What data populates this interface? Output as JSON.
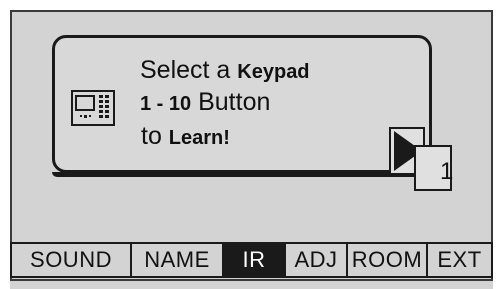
{
  "prompt": {
    "line1_normal": "Select a ",
    "line1_bold": "Keypad",
    "line2_bold": "1 - 10",
    "line2_normal": " Button",
    "line3_normal": "to ",
    "line3_bold": "Learn!"
  },
  "device_icon": "keypad-device-icon",
  "next_icon": "right-arrow-icon",
  "page_indicator": "1",
  "tabs": [
    {
      "label": "SOUND",
      "active": false
    },
    {
      "label": "NAME",
      "active": false
    },
    {
      "label": "IR",
      "active": true
    },
    {
      "label": "ADJ",
      "active": false
    },
    {
      "label": "ROOM",
      "active": false
    },
    {
      "label": "EXT",
      "active": false
    }
  ],
  "colors": {
    "screen_bg": "#d3d3d3",
    "ink": "#1a1a1a",
    "active_tab_bg": "#1a1a1a",
    "active_tab_text": "#ffffff"
  }
}
